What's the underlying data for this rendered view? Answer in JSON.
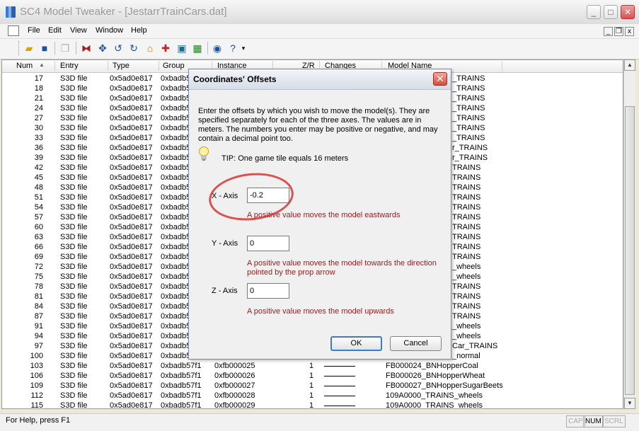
{
  "window": {
    "title": "SC4 Model Tweaker - [JestarrTrainCars.dat]",
    "minimize": "_",
    "maximize": "□",
    "close": "✕"
  },
  "menubar": {
    "items": [
      "File",
      "Edit",
      "View",
      "Window",
      "Help"
    ],
    "mdi_minimize": "_",
    "mdi_restore": "❐",
    "mdi_close": "x"
  },
  "toolbar": {
    "icons": [
      "open-icon",
      "save-icon",
      "copy-icon",
      "flip-icon",
      "move-icon",
      "rotate-ccw-icon",
      "rotate-cw-icon",
      "house-icon",
      "add-icon",
      "palette-icon",
      "grid-icon",
      "info-icon",
      "help-icon",
      "dropdown-icon"
    ]
  },
  "list": {
    "columns": [
      "Num",
      "Entry",
      "Type",
      "Group",
      "Instance",
      "Z/R",
      "Changes",
      "Model Name"
    ],
    "rows": [
      {
        "num": "17",
        "entry": "S3D file",
        "type": "0x5ad0e817",
        "group": "0xbadb5",
        "instance": "",
        "zr": "",
        "model": "_TRAINS"
      },
      {
        "num": "18",
        "entry": "S3D file",
        "type": "0x5ad0e817",
        "group": "0xbadb5",
        "instance": "",
        "zr": "",
        "model": "_TRAINS"
      },
      {
        "num": "21",
        "entry": "S3D file",
        "type": "0x5ad0e817",
        "group": "0xbadb5",
        "instance": "",
        "zr": "",
        "model": "_TRAINS"
      },
      {
        "num": "24",
        "entry": "S3D file",
        "type": "0x5ad0e817",
        "group": "0xbadb5",
        "instance": "",
        "zr": "",
        "model": "_TRAINS"
      },
      {
        "num": "27",
        "entry": "S3D file",
        "type": "0x5ad0e817",
        "group": "0xbadb5",
        "instance": "",
        "zr": "",
        "model": "_TRAINS"
      },
      {
        "num": "30",
        "entry": "S3D file",
        "type": "0x5ad0e817",
        "group": "0xbadb5",
        "instance": "",
        "zr": "",
        "model": "_TRAINS"
      },
      {
        "num": "33",
        "entry": "S3D file",
        "type": "0x5ad0e817",
        "group": "0xbadb5",
        "instance": "",
        "zr": "",
        "model": "_TRAINS"
      },
      {
        "num": "36",
        "entry": "S3D file",
        "type": "0x5ad0e817",
        "group": "0xbadb5",
        "instance": "",
        "zr": "",
        "model": "r_TRAINS"
      },
      {
        "num": "39",
        "entry": "S3D file",
        "type": "0x5ad0e817",
        "group": "0xbadb5",
        "instance": "",
        "zr": "",
        "model": "r_TRAINS"
      },
      {
        "num": "42",
        "entry": "S3D file",
        "type": "0x5ad0e817",
        "group": "0xbadb5",
        "instance": "",
        "zr": "",
        "model": "TRAINS"
      },
      {
        "num": "45",
        "entry": "S3D file",
        "type": "0x5ad0e817",
        "group": "0xbadb5",
        "instance": "",
        "zr": "",
        "model": "TRAINS"
      },
      {
        "num": "48",
        "entry": "S3D file",
        "type": "0x5ad0e817",
        "group": "0xbadb5",
        "instance": "",
        "zr": "",
        "model": "TRAINS"
      },
      {
        "num": "51",
        "entry": "S3D file",
        "type": "0x5ad0e817",
        "group": "0xbadb5",
        "instance": "",
        "zr": "",
        "model": "TRAINS"
      },
      {
        "num": "54",
        "entry": "S3D file",
        "type": "0x5ad0e817",
        "group": "0xbadb5",
        "instance": "",
        "zr": "",
        "model": "TRAINS"
      },
      {
        "num": "57",
        "entry": "S3D file",
        "type": "0x5ad0e817",
        "group": "0xbadb5",
        "instance": "",
        "zr": "",
        "model": "TRAINS"
      },
      {
        "num": "60",
        "entry": "S3D file",
        "type": "0x5ad0e817",
        "group": "0xbadb5",
        "instance": "",
        "zr": "",
        "model": "TRAINS"
      },
      {
        "num": "63",
        "entry": "S3D file",
        "type": "0x5ad0e817",
        "group": "0xbadb5",
        "instance": "",
        "zr": "",
        "model": "TRAINS"
      },
      {
        "num": "66",
        "entry": "S3D file",
        "type": "0x5ad0e817",
        "group": "0xbadb5",
        "instance": "",
        "zr": "",
        "model": "TRAINS"
      },
      {
        "num": "69",
        "entry": "S3D file",
        "type": "0x5ad0e817",
        "group": "0xbadb5",
        "instance": "",
        "zr": "",
        "model": "TRAINS"
      },
      {
        "num": "72",
        "entry": "S3D file",
        "type": "0x5ad0e817",
        "group": "0xbadb5",
        "instance": "",
        "zr": "",
        "model": "_wheels"
      },
      {
        "num": "75",
        "entry": "S3D file",
        "type": "0x5ad0e817",
        "group": "0xbadb5",
        "instance": "",
        "zr": "",
        "model": "_wheels"
      },
      {
        "num": "78",
        "entry": "S3D file",
        "type": "0x5ad0e817",
        "group": "0xbadb5",
        "instance": "",
        "zr": "",
        "model": "TRAINS"
      },
      {
        "num": "81",
        "entry": "S3D file",
        "type": "0x5ad0e817",
        "group": "0xbadb5",
        "instance": "",
        "zr": "",
        "model": "TRAINS"
      },
      {
        "num": "84",
        "entry": "S3D file",
        "type": "0x5ad0e817",
        "group": "0xbadb5",
        "instance": "",
        "zr": "",
        "model": "TRAINS"
      },
      {
        "num": "87",
        "entry": "S3D file",
        "type": "0x5ad0e817",
        "group": "0xbadb5",
        "instance": "",
        "zr": "",
        "model": "TRAINS"
      },
      {
        "num": "91",
        "entry": "S3D file",
        "type": "0x5ad0e817",
        "group": "0xbadb5",
        "instance": "",
        "zr": "",
        "model": "_wheels"
      },
      {
        "num": "94",
        "entry": "S3D file",
        "type": "0x5ad0e817",
        "group": "0xbadb5",
        "instance": "",
        "zr": "",
        "model": "_wheels"
      },
      {
        "num": "97",
        "entry": "S3D file",
        "type": "0x5ad0e817",
        "group": "0xbadb5",
        "instance": "",
        "zr": "",
        "model": "Car_TRAINS"
      },
      {
        "num": "100",
        "entry": "S3D file",
        "type": "0x5ad0e817",
        "group": "0xbadb5",
        "instance": "",
        "zr": "",
        "model": "_normal"
      },
      {
        "num": "103",
        "entry": "S3D file",
        "type": "0x5ad0e817",
        "group": "0xbadb57f1",
        "instance": "0xfb000025",
        "zr": "1",
        "model": "FB000024_BNHopperCoal"
      },
      {
        "num": "106",
        "entry": "S3D file",
        "type": "0x5ad0e817",
        "group": "0xbadb57f1",
        "instance": "0xfb000026",
        "zr": "1",
        "model": "FB000026_BNHopperWheat"
      },
      {
        "num": "109",
        "entry": "S3D file",
        "type": "0x5ad0e817",
        "group": "0xbadb57f1",
        "instance": "0xfb000027",
        "zr": "1",
        "model": "FB000027_BNHopperSugarBeets"
      },
      {
        "num": "112",
        "entry": "S3D file",
        "type": "0x5ad0e817",
        "group": "0xbadb57f1",
        "instance": "0xfb000028",
        "zr": "1",
        "model": "109A0000_TRAINS_wheels"
      },
      {
        "num": "115",
        "entry": "S3D file",
        "type": "0x5ad0e817",
        "group": "0xbadb57f1",
        "instance": "0xfb000029",
        "zr": "1",
        "model": "109A0000_TRAINS_wheels"
      }
    ]
  },
  "statusbar": {
    "text": "For Help, press F1",
    "cap": "CAP",
    "num": "NUM",
    "scrl": "SCRL"
  },
  "dialog": {
    "title": "Coordinates' Offsets",
    "close": "✕",
    "description": "Enter the offsets by which you wish to move the model(s). They are specified separately for each of the three axes. The values are in meters. The numbers you enter may be positive or negative, and may contain a decimal point too.",
    "tip": "TIP: One game tile equals 16 meters",
    "x_label": "X - Axis",
    "x_value": "-0.2",
    "x_hint": "A positive value moves the model eastwards",
    "y_label": "Y - Axis",
    "y_value": "0",
    "y_hint": "A positive value moves the model towards the direction pointed by the prop arrow",
    "z_label": "Z - Axis",
    "z_value": "0",
    "z_hint": "A positive value moves the model upwards",
    "ok": "OK",
    "cancel": "Cancel"
  },
  "colors": {
    "hint_text": "#9b1c1c",
    "annotation_circle": "#d21e1e",
    "close_button": "#d94b3a"
  }
}
